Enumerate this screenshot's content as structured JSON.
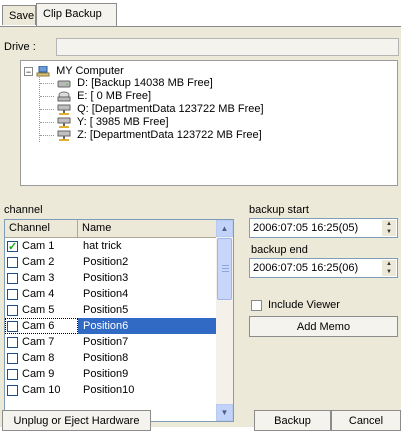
{
  "tabs": [
    {
      "label": "Save",
      "active": false
    },
    {
      "label": "Clip Backup",
      "active": true
    }
  ],
  "drive": {
    "label": "Drive :",
    "value": ""
  },
  "tree": {
    "root": "MY Computer",
    "items": [
      {
        "label": "D: [Backup 14038 MB Free]",
        "icon": "hard-drive-icon"
      },
      {
        "label": "E: [ 0 MB Free]",
        "icon": "cd-drive-icon"
      },
      {
        "label": "Q: [DepartmentData 123722 MB Free]",
        "icon": "network-drive-icon"
      },
      {
        "label": "Y: [ 3985 MB Free]",
        "icon": "network-drive-icon"
      },
      {
        "label": "Z: [DepartmentData 123722 MB Free]",
        "icon": "network-drive-icon"
      }
    ]
  },
  "channel": {
    "label": "channel",
    "columns": [
      "Channel",
      "Name"
    ],
    "rows": [
      {
        "channel": "Cam 1",
        "name": "hat trick",
        "checked": true,
        "selected": false
      },
      {
        "channel": "Cam 2",
        "name": "Position2",
        "checked": false,
        "selected": false
      },
      {
        "channel": "Cam 3",
        "name": "Position3",
        "checked": false,
        "selected": false
      },
      {
        "channel": "Cam 4",
        "name": "Position4",
        "checked": false,
        "selected": false
      },
      {
        "channel": "Cam 5",
        "name": "Position5",
        "checked": false,
        "selected": false
      },
      {
        "channel": "Cam 6",
        "name": "Position6",
        "checked": false,
        "selected": true
      },
      {
        "channel": "Cam 7",
        "name": "Position7",
        "checked": false,
        "selected": false
      },
      {
        "channel": "Cam 8",
        "name": "Position8",
        "checked": false,
        "selected": false
      },
      {
        "channel": "Cam 9",
        "name": "Position9",
        "checked": false,
        "selected": false
      },
      {
        "channel": "Cam 10",
        "name": "Position10",
        "checked": false,
        "selected": false
      }
    ]
  },
  "backup_start": {
    "label": "backup start",
    "value": "2006:07:05 16:25(05)"
  },
  "backup_end": {
    "label": "backup end",
    "value": "2006:07:05 16:25(06)"
  },
  "include_viewer": {
    "label": "Include Viewer",
    "checked": false
  },
  "buttons": {
    "add_memo": "Add Memo",
    "unplug": "Unplug or Eject Hardware",
    "backup": "Backup",
    "cancel": "Cancel"
  },
  "colors": {
    "selection": "#316ac5",
    "panel_bg": "#ece9d8",
    "scrollbar": "#c1d3fb"
  }
}
